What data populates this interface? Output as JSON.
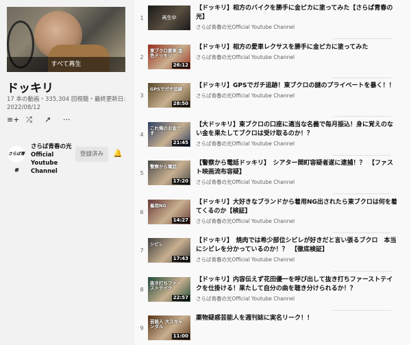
{
  "playlist": {
    "play_all": "すべて再生",
    "title": "ドッキリ",
    "meta": "17 本の動画・335,304 回視聴・最終更新日: 2022/08/12",
    "actions": {
      "add_to_queue": "≡+",
      "shuffle": "⤮",
      "share": "↗",
      "more": "···"
    }
  },
  "channel": {
    "logo_text": "さらば青春",
    "name": "さらば青春の光 Official Youtube Channel",
    "subscribed_label": "登録済み",
    "bell": "🔔"
  },
  "videos": [
    {
      "index": "1",
      "title": "【ドッキリ】相方のバイクを勝手に金ピカに塗ってみた【さらば青春の光】",
      "channel": "さらば青春の光Official Youtube Channel",
      "duration": "",
      "now_playing": "再生中",
      "thumb_text": "",
      "thumb_color": "#3a3a3a"
    },
    {
      "index": "2",
      "title": "【ドッキリ】相方の愛車レクサスを勝手に金ピカに塗ってみた",
      "channel": "さらば青春の光Official Youtube Channel",
      "duration": "26:12",
      "now_playing": "",
      "thumb_text": "東ブクロ愛車 金色ドッキリ",
      "thumb_color": "#9a2f1e"
    },
    {
      "index": "3",
      "title": "【ドッキリ】GPSでガチ追跡！東ブクロの謎のプライベートを暴く！！",
      "channel": "さらば青春の光Official Youtube Channel",
      "duration": "28:50",
      "now_playing": "",
      "thumb_text": "GPSでガチ追跡",
      "thumb_color": "#5a4a2a"
    },
    {
      "index": "4",
      "title": "【大ドッキリ】東ブクロの口座に適当な名義で毎月振込！身に覚えのない金を果たしてブクロは受け取るのか！？",
      "channel": "さらば青春の光Official Youtube Channel",
      "duration": "21:45",
      "now_playing": "",
      "thumb_text": "これ俺のお金です",
      "thumb_color": "#2d3f66"
    },
    {
      "index": "5",
      "title": "【警察から電話ドッキリ】　シアター関町容疑者遂に逮捕！？　【ファスト映画流布容疑】",
      "channel": "さらば青春の光Official Youtube Channel",
      "duration": "17:20",
      "now_playing": "",
      "thumb_text": "警察から電話",
      "thumb_color": "#4b4b4b"
    },
    {
      "index": "6",
      "title": "【ドッキリ】大好きなブランドから着用NG出されたら東ブクロは何を着てくるのか【検証】",
      "channel": "さらば青春の光Official Youtube Channel",
      "duration": "14:27",
      "now_playing": "",
      "thumb_text": "着用NG",
      "thumb_color": "#6b3a3a"
    },
    {
      "index": "7",
      "title": "【ドッキリ】　焼肉では希少部位シビレが好きだと言い張るブクロ　本当にシビレを分かっているのか！？　【徹底検証】",
      "channel": "さらば青春の光Official Youtube Channel",
      "duration": "17:43",
      "now_playing": "",
      "thumb_text": "シビレ",
      "thumb_color": "#3f3f3f"
    },
    {
      "index": "8",
      "title": "【ドッキリ】内容伝えず花田優一を呼び出して抜き打ちファーストテイクを仕掛ける！果たして自分の曲を聴き分けられるか！？",
      "channel": "さらば青春の光Official Youtube Channel",
      "duration": "22:57",
      "now_playing": "",
      "thumb_text": "抜き打ちファーストテイク",
      "thumb_color": "#1f4d3a"
    },
    {
      "index": "9",
      "title": "薬物疑惑芸能人を週刊誌に実名リーク！！",
      "channel": "",
      "duration": "11:00",
      "now_playing": "",
      "thumb_text": "芸能人 大スキャンダル",
      "thumb_color": "#5a3418"
    }
  ]
}
